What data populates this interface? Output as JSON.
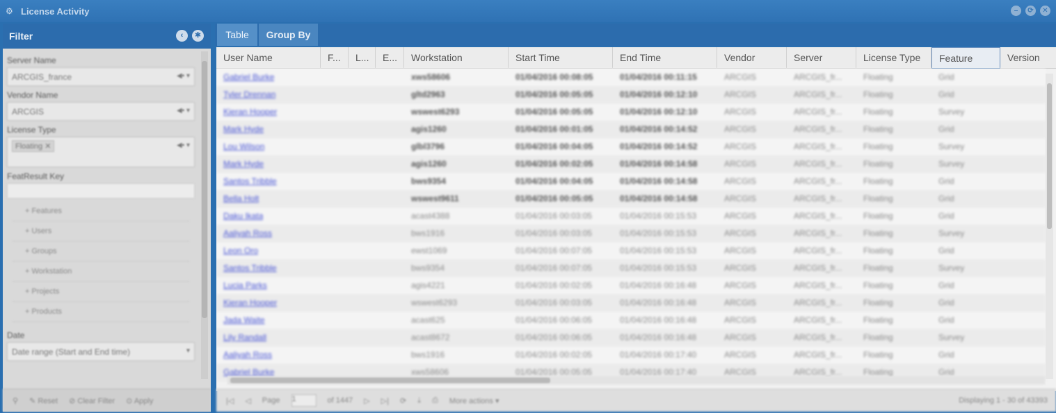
{
  "window": {
    "title": "License Activity",
    "controls": [
      "–",
      "⟳",
      "✕"
    ]
  },
  "filter": {
    "title": "Filter",
    "server_name_label": "Server Name",
    "server_name_value": "ARCGIS_france",
    "vendor_name_label": "Vendor Name",
    "vendor_name_value": "ARCGIS",
    "license_type_label": "License Type",
    "license_type_chip": "Floating",
    "keyword_label": "FeatResult Key",
    "tree_items": [
      "Features",
      "Users",
      "Groups",
      "Workstation",
      "Projects",
      "Products"
    ],
    "date_label": "Date",
    "date_value": "Date range (Start and End time)",
    "footer": {
      "reset": "Reset",
      "clear": "Clear Filter",
      "apply": "Apply"
    }
  },
  "tabs": {
    "table": "Table",
    "group_by": "Group By"
  },
  "columns": [
    "User Name",
    "F...",
    "L...",
    "E...",
    "Workstation",
    "Start Time",
    "End Time",
    "Vendor",
    "Server",
    "License Type",
    "Feature",
    "Version"
  ],
  "rows": [
    {
      "user": "Gabriel Burke",
      "ws": "xws58606",
      "start": "01/04/2016 00:08:05",
      "end": "01/04/2016 00:11:15",
      "vendor": "ARCGIS",
      "server": "ARCGIS_fr...",
      "type": "Floating",
      "feature": "Grid"
    },
    {
      "user": "Tyler Drennan",
      "ws": "gltd2963",
      "start": "01/04/2016 00:05:05",
      "end": "01/04/2016 00:12:10",
      "vendor": "ARCGIS",
      "server": "ARCGIS_fr...",
      "type": "Floating",
      "feature": "Grid"
    },
    {
      "user": "Kieran Hooper",
      "ws": "wswest6293",
      "start": "01/04/2016 00:05:05",
      "end": "01/04/2016 00:12:10",
      "vendor": "ARCGIS",
      "server": "ARCGIS_fr...",
      "type": "Floating",
      "feature": "Survey"
    },
    {
      "user": "Mark Hyde",
      "ws": "agis1260",
      "start": "01/04/2016 00:01:05",
      "end": "01/04/2016 00:14:52",
      "vendor": "ARCGIS",
      "server": "ARCGIS_fr...",
      "type": "Floating",
      "feature": "Grid"
    },
    {
      "user": "Lou Wilson",
      "ws": "glbl3796",
      "start": "01/04/2016 00:04:05",
      "end": "01/04/2016 00:14:52",
      "vendor": "ARCGIS",
      "server": "ARCGIS_fr...",
      "type": "Floating",
      "feature": "Survey"
    },
    {
      "user": "Mark Hyde",
      "ws": "agis1260",
      "start": "01/04/2016 00:02:05",
      "end": "01/04/2016 00:14:58",
      "vendor": "ARCGIS",
      "server": "ARCGIS_fr...",
      "type": "Floating",
      "feature": "Survey"
    },
    {
      "user": "Santos Tribble",
      "ws": "bws9354",
      "start": "01/04/2016 00:04:05",
      "end": "01/04/2016 00:14:58",
      "vendor": "ARCGIS",
      "server": "ARCGIS_fr...",
      "type": "Floating",
      "feature": "Grid"
    },
    {
      "user": "Bella Holt",
      "ws": "wswest9611",
      "start": "01/04/2016 00:05:05",
      "end": "01/04/2016 00:14:58",
      "vendor": "ARCGIS",
      "server": "ARCGIS_fr...",
      "type": "Floating",
      "feature": "Grid"
    },
    {
      "user": "Daku Ikata",
      "ws": "acast4388",
      "start": "01/04/2016 00:03:05",
      "end": "01/04/2016 00:15:53",
      "vendor": "ARCGIS",
      "server": "ARCGIS_fr...",
      "type": "Floating",
      "feature": "Grid"
    },
    {
      "user": "Aaliyah Ross",
      "ws": "bws1916",
      "start": "01/04/2016 00:03:05",
      "end": "01/04/2016 00:15:53",
      "vendor": "ARCGIS",
      "server": "ARCGIS_fr...",
      "type": "Floating",
      "feature": "Survey"
    },
    {
      "user": "Leon Oro",
      "ws": "ewst1069",
      "start": "01/04/2016 00:07:05",
      "end": "01/04/2016 00:15:53",
      "vendor": "ARCGIS",
      "server": "ARCGIS_fr...",
      "type": "Floating",
      "feature": "Grid"
    },
    {
      "user": "Santos Tribble",
      "ws": "bws9354",
      "start": "01/04/2016 00:07:05",
      "end": "01/04/2016 00:15:53",
      "vendor": "ARCGIS",
      "server": "ARCGIS_fr...",
      "type": "Floating",
      "feature": "Survey"
    },
    {
      "user": "Lucia Parks",
      "ws": "agis4221",
      "start": "01/04/2016 00:02:05",
      "end": "01/04/2016 00:16:48",
      "vendor": "ARCGIS",
      "server": "ARCGIS_fr...",
      "type": "Floating",
      "feature": "Grid"
    },
    {
      "user": "Kieran Hooper",
      "ws": "wswest6293",
      "start": "01/04/2016 00:03:05",
      "end": "01/04/2016 00:16:48",
      "vendor": "ARCGIS",
      "server": "ARCGIS_fr...",
      "type": "Floating",
      "feature": "Grid"
    },
    {
      "user": "Jada Waite",
      "ws": "acast625",
      "start": "01/04/2016 00:06:05",
      "end": "01/04/2016 00:16:48",
      "vendor": "ARCGIS",
      "server": "ARCGIS_fr...",
      "type": "Floating",
      "feature": "Grid"
    },
    {
      "user": "Lily Randall",
      "ws": "acast8672",
      "start": "01/04/2016 00:06:05",
      "end": "01/04/2016 00:16:48",
      "vendor": "ARCGIS",
      "server": "ARCGIS_fr...",
      "type": "Floating",
      "feature": "Survey"
    },
    {
      "user": "Aaliyah Ross",
      "ws": "bws1916",
      "start": "01/04/2016 00:02:05",
      "end": "01/04/2016 00:17:40",
      "vendor": "ARCGIS",
      "server": "ARCGIS_fr...",
      "type": "Floating",
      "feature": "Grid"
    },
    {
      "user": "Gabriel Burke",
      "ws": "xws58606",
      "start": "01/04/2016 00:05:05",
      "end": "01/04/2016 00:17:40",
      "vendor": "ARCGIS",
      "server": "ARCGIS_fr...",
      "type": "Floating",
      "feature": "Grid"
    }
  ],
  "pager": {
    "page_label": "Page",
    "page_value": "1",
    "of_label": "of 1447",
    "more_actions": "More actions",
    "display": "Displaying 1 - 30 of 43393"
  }
}
